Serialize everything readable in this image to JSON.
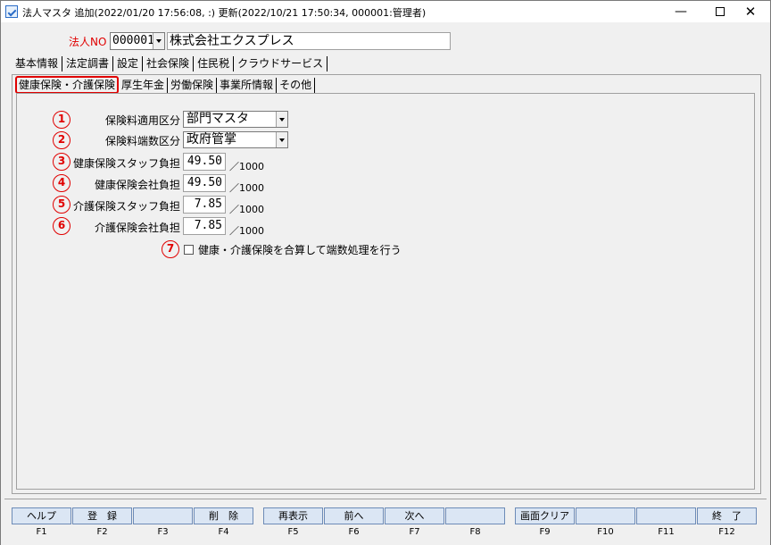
{
  "window": {
    "title": "法人マスタ  追加(2022/01/20 17:56:08, :)  更新(2022/10/21 17:50:34, 000001:管理者)",
    "minimize": "—",
    "close": "✕"
  },
  "header": {
    "corp_label": "法人NO",
    "corp_no": "000001",
    "corp_name": "株式会社エクスプレス"
  },
  "tabs_main": [
    {
      "label": "基本情報"
    },
    {
      "label": "法定調書"
    },
    {
      "label": "設定"
    },
    {
      "label": "社会保険"
    },
    {
      "label": "住民税"
    },
    {
      "label": "クラウドサービス"
    }
  ],
  "tabs_sub": [
    {
      "label": "健康保険・介護保険"
    },
    {
      "label": "厚生年金"
    },
    {
      "label": "労働保険"
    },
    {
      "label": "事業所情報"
    },
    {
      "label": "その他"
    }
  ],
  "form": {
    "rows": [
      {
        "num": "1",
        "label": "保険料適用区分",
        "value": "部門マスタ"
      },
      {
        "num": "2",
        "label": "保険料端数区分",
        "value": "政府管掌"
      },
      {
        "num": "3",
        "label": "健康保険スタッフ負担",
        "value": "49.50",
        "unit": "／1000"
      },
      {
        "num": "4",
        "label": "健康保険会社負担",
        "value": "49.50",
        "unit": "／1000"
      },
      {
        "num": "5",
        "label": "介護保険スタッフ負担",
        "value": "7.85",
        "unit": "／1000"
      },
      {
        "num": "6",
        "label": "介護保険会社負担",
        "value": "7.85",
        "unit": "／1000"
      }
    ],
    "checkbox": {
      "num": "7",
      "label": "健康・介護保険を合算して端数処理を行う",
      "checked": false
    }
  },
  "fkeys": [
    {
      "label": "ヘルプ",
      "name": "F1"
    },
    {
      "label": "登　録",
      "name": "F2"
    },
    {
      "label": "",
      "name": "F3"
    },
    {
      "label": "削　除",
      "name": "F4"
    },
    {
      "label": "再表示",
      "name": "F5"
    },
    {
      "label": "前へ",
      "name": "F6"
    },
    {
      "label": "次へ",
      "name": "F7"
    },
    {
      "label": "",
      "name": "F8"
    },
    {
      "label": "画面クリア",
      "name": "F9"
    },
    {
      "label": "",
      "name": "F10"
    },
    {
      "label": "",
      "name": "F11"
    },
    {
      "label": "終　了",
      "name": "F12"
    }
  ],
  "colors": {
    "accent": "#e00000",
    "fkey_bg": "#dbe6f4",
    "fkey_border": "#6d8bb7"
  }
}
